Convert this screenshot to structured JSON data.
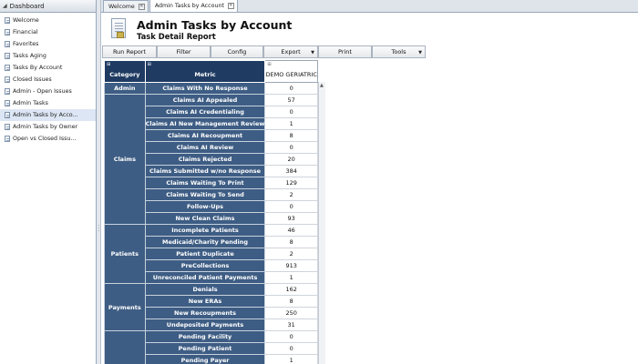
{
  "sidebar": {
    "header": "Dashboard",
    "items": [
      {
        "label": "Welcome"
      },
      {
        "label": "Financial"
      },
      {
        "label": "Favorites"
      },
      {
        "label": "Tasks Aging"
      },
      {
        "label": "Tasks By Account"
      },
      {
        "label": "Closed Issues"
      },
      {
        "label": "Admin - Open Issues"
      },
      {
        "label": "Admin Tasks"
      },
      {
        "label": "Admin Tasks by Acco..."
      },
      {
        "label": "Admin Tasks by Owner"
      },
      {
        "label": "Open vs Closed Issu..."
      }
    ]
  },
  "tabs": [
    {
      "label": "Welcome"
    },
    {
      "label": "Admin Tasks by Account"
    }
  ],
  "report": {
    "title": "Admin Tasks by Account",
    "subtitle": "Task Detail Report"
  },
  "toolbar": {
    "run": "Run Report",
    "filter": "Filter",
    "config": "Config",
    "export": "Export",
    "print": "Print",
    "tools": "Tools"
  },
  "grid": {
    "headers": {
      "category": "Category",
      "metric": "Metric",
      "value": "DEMO GERIATRIC"
    },
    "groups": [
      {
        "category": "Admin",
        "rows": [
          {
            "metric": "Claims With No Response",
            "value": "0"
          }
        ]
      },
      {
        "category": "Claims",
        "rows": [
          {
            "metric": "Claims AI Appealed",
            "value": "57"
          },
          {
            "metric": "Claims AI Credentialing",
            "value": "0"
          },
          {
            "metric": "Claims AI New Management Review",
            "value": "1"
          },
          {
            "metric": "Claims AI Recoupment",
            "value": "8"
          },
          {
            "metric": "Claims AI Review",
            "value": "0"
          },
          {
            "metric": "Claims Rejected",
            "value": "20"
          },
          {
            "metric": "Claims Submitted w/no Response",
            "value": "384"
          },
          {
            "metric": "Claims Waiting To Print",
            "value": "129"
          },
          {
            "metric": "Claims Waiting To Send",
            "value": "2"
          },
          {
            "metric": "Follow-Ups",
            "value": "0"
          },
          {
            "metric": "New Clean Claims",
            "value": "93"
          }
        ]
      },
      {
        "category": "Patients",
        "rows": [
          {
            "metric": "Incomplete Patients",
            "value": "46"
          },
          {
            "metric": "Medicaid/Charity Pending",
            "value": "8"
          },
          {
            "metric": "Patient Duplicate",
            "value": "2"
          },
          {
            "metric": "PreCollections",
            "value": "913"
          },
          {
            "metric": "Unreconciled Patient Payments",
            "value": "1"
          }
        ]
      },
      {
        "category": "Payments",
        "rows": [
          {
            "metric": "Denials",
            "value": "162"
          },
          {
            "metric": "New ERAs",
            "value": "8"
          },
          {
            "metric": "New Recoupments",
            "value": "250"
          },
          {
            "metric": "Undeposited Payments",
            "value": "31"
          }
        ]
      },
      {
        "category": "",
        "rows": [
          {
            "metric": "Pending Facility",
            "value": "0"
          },
          {
            "metric": "Pending Patient",
            "value": "0"
          },
          {
            "metric": "Pending Payer",
            "value": "1"
          }
        ]
      }
    ]
  }
}
